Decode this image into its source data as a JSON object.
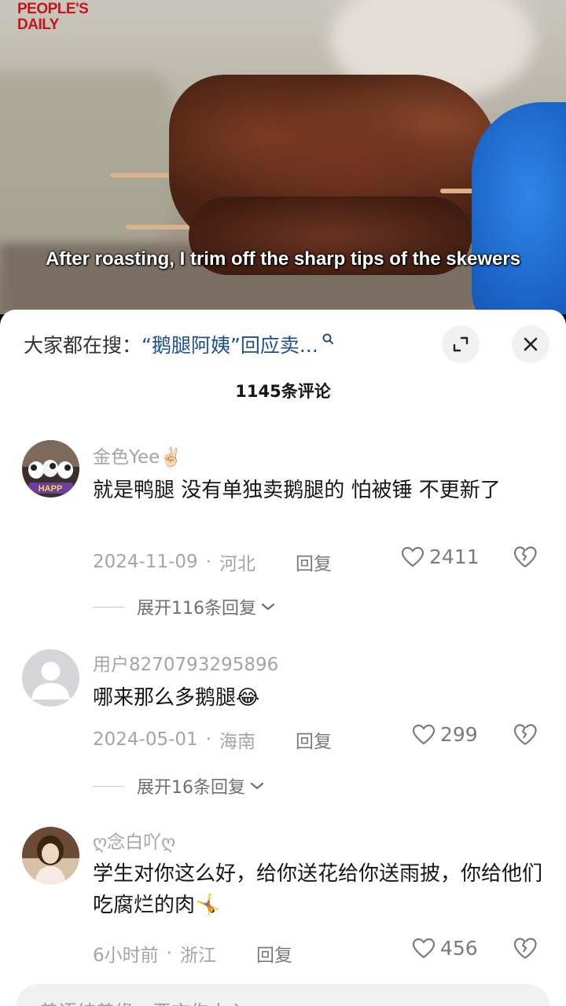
{
  "video": {
    "logo_line1": "PEOPLE'S",
    "logo_line2": "DAILY",
    "subtitle": "After roasting, I trim off the sharp tips of the skewers"
  },
  "sheet": {
    "search_prefix": "大家都在搜：",
    "search_link": "“鹅腿阿姨”回应卖...",
    "comment_count": "1145条评论",
    "input_placeholder": "善语结善缘，恶言伤人心"
  },
  "comments": [
    {
      "username": "金色Yee✌🏻",
      "text": "就是鸭腿 没有单独卖鹅腿的 怕被锤 不更新了",
      "date": "2024-11-09",
      "location": "河北",
      "reply_label": "回复",
      "likes": "2411",
      "expand_label": "展开116条回复"
    },
    {
      "username": "用户8270793295896",
      "text": "哪来那么多鹅腿😂",
      "date": "2024-05-01",
      "location": "海南",
      "reply_label": "回复",
      "likes": "299",
      "expand_label": "展开16条回复"
    },
    {
      "username": "ღ念白吖ღ",
      "text": "学生对你这么好，给你送花给你送雨披，你给他们吃腐烂的肉🤸",
      "date": "6小时前",
      "location": "浙江",
      "reply_label": "回复",
      "likes": "456"
    }
  ],
  "colors": {
    "link": "#1d4f91",
    "meta_gray": "#a5a5a8",
    "logo_red": "#c8141b"
  }
}
